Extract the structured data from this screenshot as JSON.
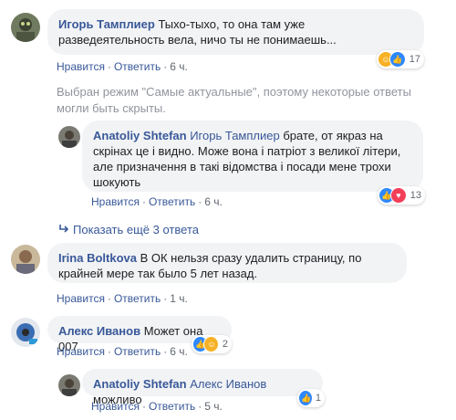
{
  "comments": [
    {
      "author": "Игорь Тамплиер",
      "text": "Тыхо-тыхо, то она там уже разведеятельность вела, ничо ты не понимаешь...",
      "like": "Нравится",
      "reply": "Ответить",
      "time": "6 ч.",
      "reactions": {
        "count": "17",
        "types": [
          "haha",
          "like"
        ]
      }
    },
    {
      "author": "Anatoliy Shtefan",
      "mention": "Игорь Тамплиер",
      "text": "брате, от якраз на скрінах це і видно. Може вона і патріот з великої літери, але призначення в такі відомства і посади мене трохи шокують",
      "like": "Нравится",
      "reply": "Ответить",
      "time": "6 ч.",
      "reactions": {
        "count": "13",
        "types": [
          "like",
          "love"
        ]
      }
    },
    {
      "author": "Irina Boltkova",
      "text": "В ОК нельзя сразу удалить страницу, по крайней мере так было 5 лет назад.",
      "like": "Нравится",
      "reply": "Ответить",
      "time": "1 ч."
    },
    {
      "author": "Алекс Иванов",
      "text": "Может она 007",
      "like": "Нравится",
      "reply": "Ответить",
      "time": "6 ч.",
      "reactions": {
        "count": "2",
        "types": [
          "like",
          "haha"
        ]
      }
    },
    {
      "author": "Anatoliy Shtefan",
      "mention": "Алекс Иванов",
      "text": "можливо",
      "like": "Нравится",
      "reply": "Ответить",
      "time": "5 ч.",
      "reactions": {
        "count": "1",
        "types": [
          "like"
        ]
      }
    }
  ],
  "notice": "Выбран режим \"Самые актуальные\", поэтому некоторые ответы могли быть скрыты.",
  "show_more": "Показать ещё 3 ответа",
  "colors": {
    "link": "#385898",
    "bubble": "#f2f3f5",
    "like": "#2d88ff",
    "love": "#f33e58",
    "haha": "#f7b125"
  }
}
